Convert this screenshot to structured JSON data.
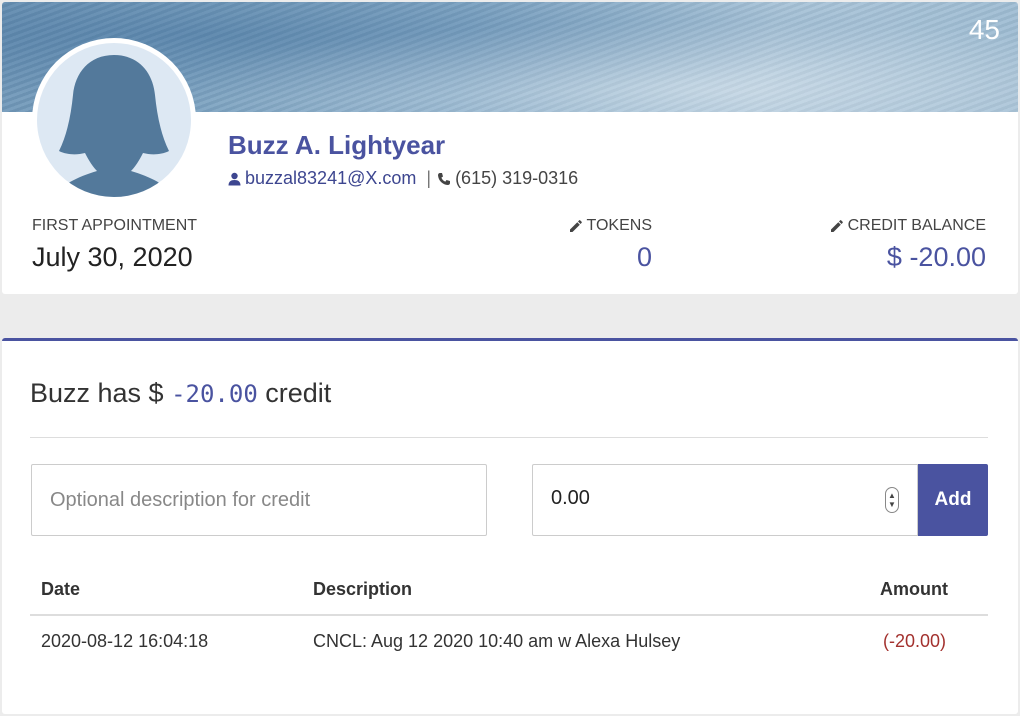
{
  "header": {
    "badge_count": "45",
    "name": "Buzz A. Lightyear",
    "email": "buzzal83241@X.com",
    "separator": "|",
    "phone": "(615) 319-0316"
  },
  "stats": {
    "first_appointment_label": "FIRST APPOINTMENT",
    "first_appointment_value": "July 30, 2020",
    "tokens_label": "TOKENS",
    "tokens_value": "0",
    "credit_label": "CREDIT BALANCE",
    "credit_value": "$ -20.00"
  },
  "credit": {
    "summary_prefix": "Buzz has $ ",
    "summary_amount": "-20.00",
    "summary_suffix": " credit",
    "description_placeholder": "Optional description for credit",
    "amount_value": "0.00",
    "add_label": "Add"
  },
  "table": {
    "headers": {
      "date": "Date",
      "description": "Description",
      "amount": "Amount"
    },
    "rows": [
      {
        "date": "2020-08-12 16:04:18",
        "description": "CNCL: Aug 12 2020 10:40 am w Alexa Hulsey",
        "amount": "(-20.00)"
      }
    ]
  },
  "colors": {
    "accent": "#4a53a0",
    "negative": "#a3312e"
  },
  "icons": [
    "person-icon",
    "phone-icon",
    "pencil-icon"
  ]
}
